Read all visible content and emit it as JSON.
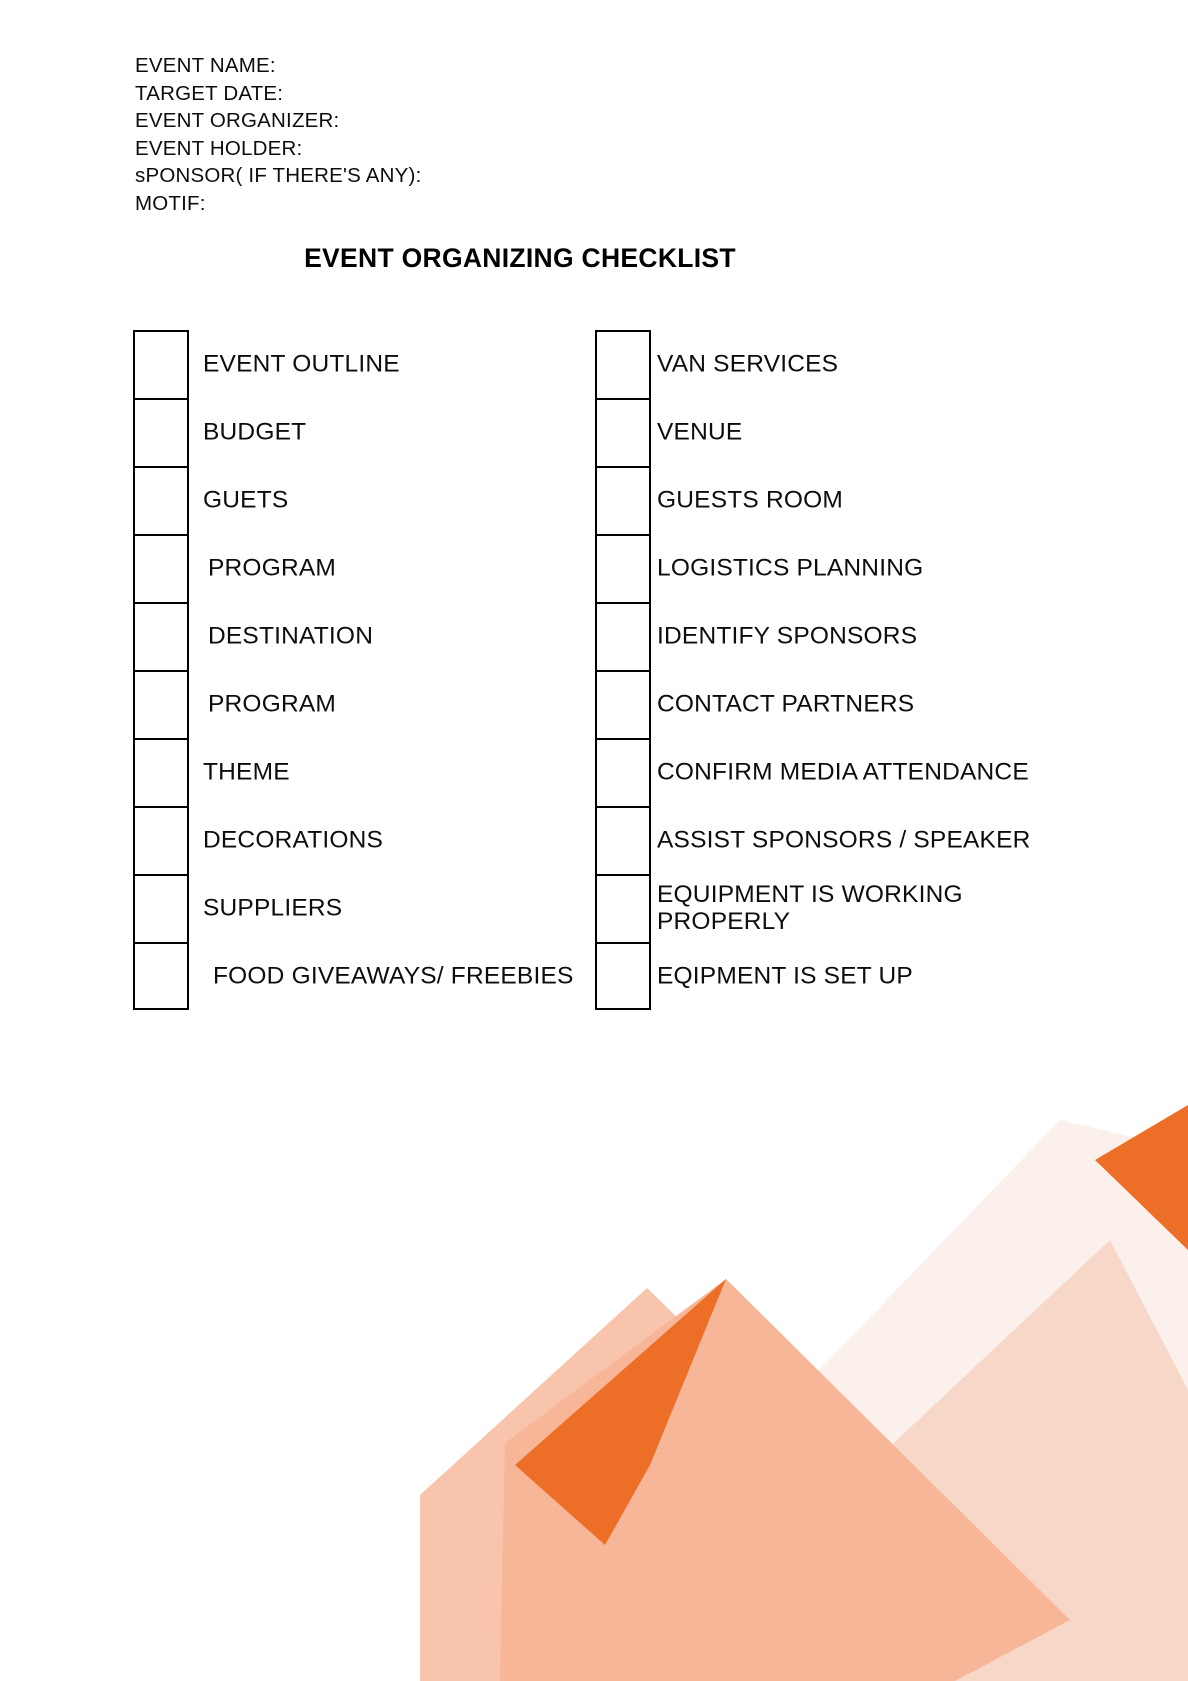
{
  "document": {
    "title": "EVENT ORGANIZING CHECKLIST"
  },
  "header": {
    "fields": [
      {
        "label": "EVENT NAME:"
      },
      {
        "label": "TARGET DATE:"
      },
      {
        "label": "EVENT ORGANIZER:"
      },
      {
        "label": "EVENT HOLDER:"
      },
      {
        "label": "sPONSOR( IF THERE'S ANY):"
      },
      {
        "label": "MOTIF:"
      }
    ]
  },
  "checklist": {
    "left_column": [
      {
        "label": "EVENT OUTLINE",
        "checked": false
      },
      {
        "label": "BUDGET",
        "checked": false
      },
      {
        "label": "GUETS",
        "checked": false
      },
      {
        "label": "PROGRAM",
        "checked": false
      },
      {
        "label": "DESTINATION",
        "checked": false
      },
      {
        "label": "PROGRAM",
        "checked": false
      },
      {
        "label": "THEME",
        "checked": false
      },
      {
        "label": "DECORATIONS",
        "checked": false
      },
      {
        "label": "SUPPLIERS",
        "checked": false
      },
      {
        "label": "FOOD GIVEAWAYS/ FREEBIES",
        "checked": false
      }
    ],
    "right_column": [
      {
        "label": "VAN SERVICES",
        "checked": false
      },
      {
        "label": "VENUE",
        "checked": false
      },
      {
        "label": "GUESTS ROOM",
        "checked": false
      },
      {
        "label": "LOGISTICS PLANNING",
        "checked": false
      },
      {
        "label": "IDENTIFY SPONSORS",
        "checked": false
      },
      {
        "label": "CONTACT PARTNERS",
        "checked": false
      },
      {
        "label": "CONFIRM MEDIA ATTENDANCE",
        "checked": false
      },
      {
        "label": "ASSIST SPONSORS  / SPEAKER",
        "checked": false
      },
      {
        "label": "EQUIPMENT IS WORKING PROPERLY",
        "checked": false
      },
      {
        "label": "EQIPMENT IS SET UP",
        "checked": false
      }
    ]
  },
  "colors": {
    "page_background": "#ffffff",
    "text": "#0d0d0d",
    "checkbox_border": "#000000",
    "accent_orange": "#ED6E27",
    "accent_salmon": "#F7B698",
    "accent_peach": "#F8C4AC",
    "accent_blush": "#F7D7C8",
    "accent_pale": "#FBF0EC"
  }
}
